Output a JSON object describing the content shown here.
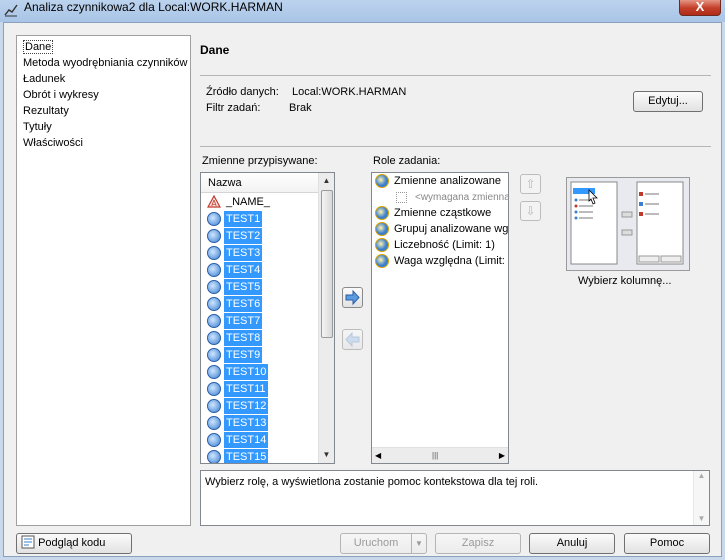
{
  "window": {
    "title": "Analiza czynnikowa2 dla Local:WORK.HARMAN",
    "close_label": "X"
  },
  "nav": {
    "items": [
      {
        "label": "Dane"
      },
      {
        "label": "Metoda wyodrębniania czynników"
      },
      {
        "label": "Ładunek"
      },
      {
        "label": "Obrót i wykresy"
      },
      {
        "label": "Rezultaty"
      },
      {
        "label": "Tytuły"
      },
      {
        "label": "Właściwości"
      }
    ]
  },
  "panel": {
    "heading": "Dane",
    "source_label": "Źródło danych:",
    "source_value": "Local:WORK.HARMAN",
    "filter_label": "Filtr zadań:",
    "filter_value": "Brak",
    "edit_button": "Edytuj..."
  },
  "variables": {
    "label": "Zmienne przypisywane:",
    "column_header": "Nazwa",
    "items": [
      {
        "name": "_NAME_",
        "type": "char",
        "selected": false
      },
      {
        "name": "TEST1",
        "type": "numeric",
        "selected": true
      },
      {
        "name": "TEST2",
        "type": "numeric",
        "selected": true
      },
      {
        "name": "TEST3",
        "type": "numeric",
        "selected": true
      },
      {
        "name": "TEST4",
        "type": "numeric",
        "selected": true
      },
      {
        "name": "TEST5",
        "type": "numeric",
        "selected": true
      },
      {
        "name": "TEST6",
        "type": "numeric",
        "selected": true
      },
      {
        "name": "TEST7",
        "type": "numeric",
        "selected": true
      },
      {
        "name": "TEST8",
        "type": "numeric",
        "selected": true
      },
      {
        "name": "TEST9",
        "type": "numeric",
        "selected": true
      },
      {
        "name": "TEST10",
        "type": "numeric",
        "selected": true
      },
      {
        "name": "TEST11",
        "type": "numeric",
        "selected": true
      },
      {
        "name": "TEST12",
        "type": "numeric",
        "selected": true
      },
      {
        "name": "TEST13",
        "type": "numeric",
        "selected": true
      },
      {
        "name": "TEST14",
        "type": "numeric",
        "selected": true
      },
      {
        "name": "TEST15",
        "type": "numeric",
        "selected": true
      }
    ]
  },
  "roles": {
    "label": "Role zadania:",
    "items": [
      {
        "label": "Zmienne analizowane",
        "sub": "<wymagana zmienna>"
      },
      {
        "label": "Zmienne cząstkowe"
      },
      {
        "label": "Grupuj analizowane wg"
      },
      {
        "label": "Liczebność  (Limit: 1)"
      },
      {
        "label": "Waga względna  (Limit:"
      }
    ]
  },
  "preview": {
    "caption": "Wybierz kolumnę..."
  },
  "help": {
    "text": "Wybierz rolę, a wyświetlona zostanie pomoc kontekstowa dla tej roli."
  },
  "footer": {
    "preview_code": "Podgląd kodu",
    "run": "Uruchom",
    "save": "Zapisz",
    "cancel": "Anuluj",
    "help": "Pomoc"
  },
  "colors": {
    "selection": "#3399ff",
    "window_bg": "#f0f0f0"
  }
}
